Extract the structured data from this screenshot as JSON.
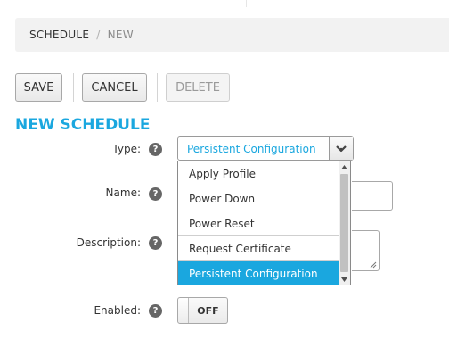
{
  "breadcrumb": {
    "items": [
      "SCHEDULE",
      "NEW"
    ],
    "separator": "/"
  },
  "toolbar": {
    "save_label": "SAVE",
    "cancel_label": "CANCEL",
    "delete_label": "DELETE",
    "delete_disabled": true
  },
  "page_title": "NEW SCHEDULE",
  "form": {
    "type_label": "Type:",
    "type_value": "Persistent Configuration",
    "type_options": [
      "Apply Profile",
      "Power Down",
      "Power Reset",
      "Request Certificate",
      "Persistent Configuration"
    ],
    "type_selected_index": 4,
    "name_label": "Name:",
    "name_value": "",
    "description_label": "Description:",
    "description_value": "",
    "enabled_label": "Enabled:",
    "enabled_toggle_label": "OFF",
    "help_glyph": "?"
  },
  "icons": {
    "help": "question-circle-icon",
    "select_arrow": "chevron-down-icon",
    "scroll_up": "arrow-up-icon",
    "scroll_down": "arrow-down-icon"
  },
  "colors": {
    "accent": "#1aa7df",
    "breadcrumb_bg": "#f2f2f2",
    "text": "#333333"
  }
}
